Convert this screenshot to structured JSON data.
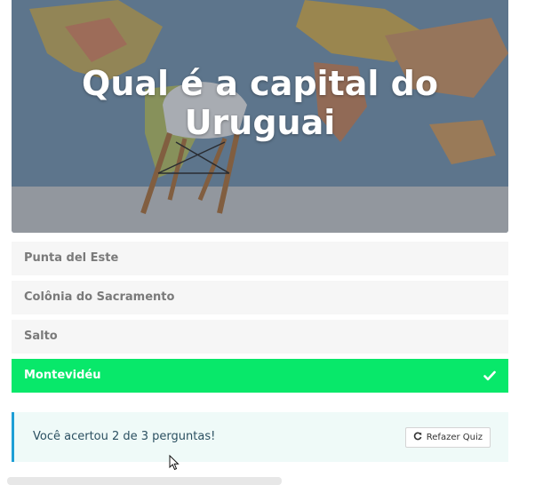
{
  "quiz": {
    "question": "Qual é a capital do Uruguai",
    "answers": [
      {
        "label": "Punta del Este",
        "correct": false
      },
      {
        "label": "Colônia do Sacramento",
        "correct": false
      },
      {
        "label": "Salto",
        "correct": false
      },
      {
        "label": "Montevidéu",
        "correct": true
      }
    ],
    "result": {
      "message": "Você acertou 2 de 3 perguntas!",
      "retake_label": "Refazer Quiz"
    }
  },
  "colors": {
    "correct": "#08e86a",
    "answer_bg": "#f6f6f6",
    "result_bg": "#effaf8",
    "result_border": "#1e9fd6"
  },
  "icons": {
    "check": "check-icon",
    "retake": "refresh-icon",
    "cursor": "mouse-cursor-icon"
  }
}
